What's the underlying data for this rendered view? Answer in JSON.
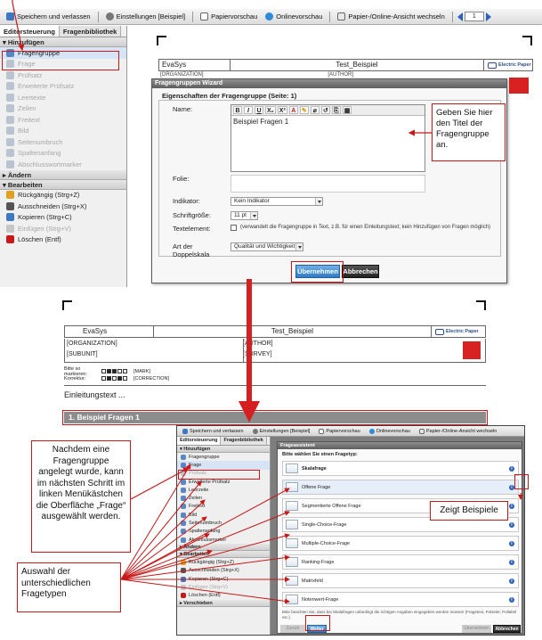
{
  "toolbar": {
    "save_exit": "Speichern und verlassen",
    "settings": "Einstellungen [Beispiel]",
    "paper_preview": "Papiervorschau",
    "online_preview": "Onlinevorschau",
    "switch_view": "Papier-/Online-Ansicht wechseln",
    "page_value": "1"
  },
  "sidebar": {
    "tab_editor": "Editorsteuerung",
    "tab_library": "Fragenbibliothek",
    "section_add": "▾ Hinzufügen",
    "add_items": [
      "Fragengruppe",
      "Frage",
      "Prüfsatz",
      "Erweiterte Prüfsatz",
      "Leertexte",
      "Zeilen",
      "Freitext",
      "Bild",
      "Seitenumbruch",
      "Spaltenanfang",
      "Abschlusswortmarker"
    ],
    "section_change": "▸ Ändern",
    "section_edit": "▾ Bearbeiten",
    "edit_items": [
      "Rückgängig (Strg+Z)",
      "Ausschneiden (Strg+X)",
      "Kopieren (Strg+C)",
      "Einfügen (Strg+V)",
      "Löschen (Entf)"
    ]
  },
  "editor": {
    "evasys": "EvaSys",
    "title": "Test_Beispiel",
    "brand": "Electric Paper",
    "org_partial": "[ORGANIZATION]",
    "author_partial": "[AUTHOR]"
  },
  "wizard": {
    "title": "Fragengruppen Wizard",
    "fieldset": "Eigenschaften der Fragengruppe (Seite: 1)",
    "name_label": "Name:",
    "name_value": "Beispiel Fragen 1",
    "folie_label": "Folie:",
    "indicator_label": "Indikator:",
    "indicator_value": "Kein Indikator",
    "font_size_label": "Schriftgröße:",
    "font_size_value": "11 pt",
    "text_element_label": "Textelement:",
    "text_element_hint": "(verwandelt die Fragengruppe in Text, z.B. für einen Einleitungstext; kein Hinzufügen von Fragen möglich)",
    "scale_label_1": "Art der",
    "scale_label_2": "Doppelskala",
    "scale_value": "Qualität und Wichtigkeit",
    "apply": "Übernehmen",
    "cancel": "Abbrechen",
    "rte_buttons": [
      "B",
      "I",
      "U",
      "X₂",
      "X²",
      "A",
      "✎",
      "⌀",
      "↺",
      "⎘",
      "▦"
    ]
  },
  "callouts": {
    "title_hint": "Geben Sie hier den Titel der Fragengruppe an.",
    "examples": "Zeigt Beispiele",
    "next_step": "Nachdem eine Fragengruppe angelegt wurde, kann im nächsten Schritt im linken Menükästchen die Oberfläche „Frage“ ausgewählt werden.",
    "types": "Auswahl der unterschiedlichen Fragetypen"
  },
  "preview": {
    "evasys": "EvaSys",
    "title": "Test_Beispiel",
    "brand": "Electric Paper",
    "organization": "[ORGANIZATION]",
    "subunit": "[SUBUNIT]",
    "author": "[AUTHOR]",
    "survey": "[SURVEY]",
    "mark_label": "Bitte so markieren:",
    "mark_tag": "[MARK]",
    "correction_label": "Korrektur:",
    "correction_tag": "[CORRECTION]",
    "intro": "Einleitungstext ...",
    "group_bar": "1. Beispiel Fragen 1"
  },
  "window2": {
    "toolbar": [
      "Speichern und verlassen",
      "Einstellungen [Beispiel]",
      "Papiervorschau",
      "Onlinevorschau",
      "Papier-/Online-Ansicht wechseln"
    ],
    "tab_editor": "Editorsteuerung",
    "tab_library": "Fragenbibliothek",
    "section_add": "▾ Hinzufügen",
    "add_items": [
      "Fragengruppe",
      "Frage",
      "Prüfsatz",
      "Erweiterte Prüfsatz",
      "Leerzeile",
      "Zeilen",
      "Freitext",
      "Bild",
      "Seitenumbruch",
      "Spaltenanfang",
      "Abschlussmarker"
    ],
    "section_change": "▸ Ändern",
    "section_edit": "▾ Bearbeiten",
    "edit_items": [
      "Rückgängig (Strg+Z)",
      "Ausschneiden (Strg+X)",
      "Kopieren (Strg+C)",
      "Einfügen (Strg+V)",
      "Löschen (Entf)"
    ],
    "section_move": "▸ Verschieben",
    "assistant_title": "Frageassistent",
    "assistant_prompt": "Bitte wählen Sie einen Fragetyp:",
    "question_types": [
      "Skalafrage",
      "Offene Frage",
      "Segmentierte Offene Frage",
      "Single-Choice-Frage",
      "Multiple-Choice-Frage",
      "Ranking-Frage",
      "Matrixfeld",
      "Notenwert-Frage"
    ],
    "footnote": "Bitte beachten Sie, dass bei Skalafragen unbedingt die richtigen Angaben eingegeben werden müssen (Fragetext, Polseite, Pollabel etc.).",
    "back": "Zurück",
    "next": "Weiter",
    "apply": "Übernehmen",
    "cancel": "Abbrechen"
  },
  "colors": {
    "annotation_red": "#c81818",
    "accent_blue": "#2e7cc6"
  }
}
